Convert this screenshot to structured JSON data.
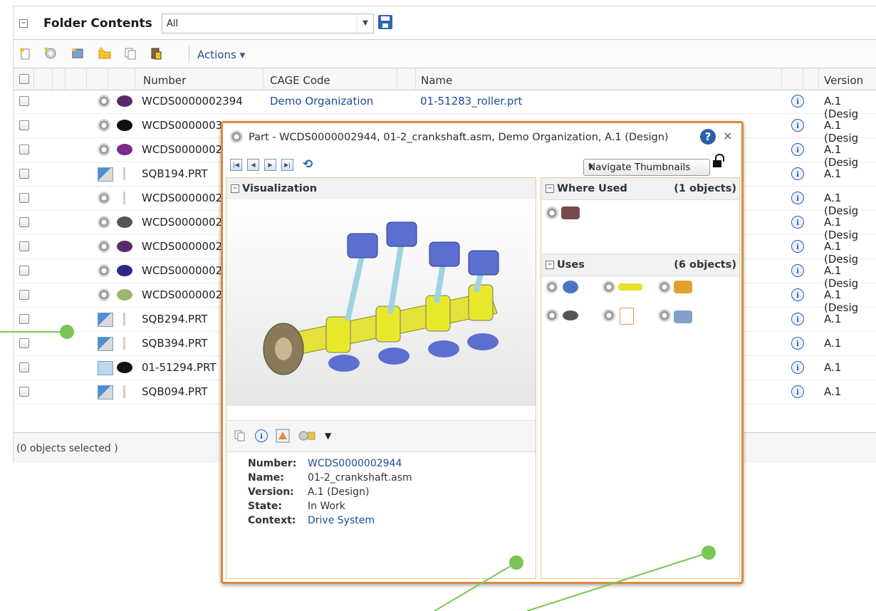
{
  "header": {
    "title": "Folder Contents",
    "filter_value": "All"
  },
  "toolbar": {
    "actions_label": "Actions"
  },
  "columns": {
    "number": "Number",
    "cage": "CAGE Code",
    "name": "Name",
    "version": "Version"
  },
  "rows": [
    {
      "number": "WCDS0000002394",
      "cage": "Demo Organization",
      "name": "01-51283_roller.prt",
      "version": "A.1 (Desig"
    },
    {
      "number": "WCDS0000003",
      "cage": "",
      "name": "",
      "version": "A.1 (Desig"
    },
    {
      "number": "WCDS0000002",
      "cage": "",
      "name": "",
      "version": "A.1 (Desig"
    },
    {
      "number": "SQB194.PRT",
      "cage": "",
      "name": "",
      "version": "A.1"
    },
    {
      "number": "WCDS0000002",
      "cage": "",
      "name": "",
      "version": "A.1 (Desig"
    },
    {
      "number": "WCDS0000002",
      "cage": "",
      "name": "",
      "version": "A.1 (Desig"
    },
    {
      "number": "WCDS0000002",
      "cage": "",
      "name": "",
      "version": "A.1 (Desig"
    },
    {
      "number": "WCDS0000002",
      "cage": "",
      "name": "",
      "version": "A.1 (Desig"
    },
    {
      "number": "WCDS0000002",
      "cage": "",
      "name": "",
      "version": "A.1 (Desig"
    },
    {
      "number": "SQB294.PRT",
      "cage": "",
      "name": "",
      "version": "A.1"
    },
    {
      "number": "SQB394.PRT",
      "cage": "",
      "name": "",
      "version": "A.1"
    },
    {
      "number": "01-51294.PRT",
      "cage": "",
      "name": "",
      "version": "A.1"
    },
    {
      "number": "SQB094.PRT",
      "cage": "",
      "name": "",
      "version": "A.1"
    }
  ],
  "footer": {
    "status": "(0 objects selected )"
  },
  "popup": {
    "title": "Part - WCDS0000002944, 01-2_crankshaft.asm, Demo Organization, A.1 (Design)",
    "navigate_label": "Navigate Thumbnails",
    "visualization_label": "Visualization",
    "where_used_label": "Where Used",
    "where_used_count": "(1 objects)",
    "uses_label": "Uses",
    "uses_count": "(6 objects)",
    "props": {
      "number_label": "Number:",
      "number": "WCDS0000002944",
      "name_label": "Name:",
      "name": "01-2_crankshaft.asm",
      "version_label": "Version:",
      "version": "A.1 (Design)",
      "state_label": "State:",
      "state": "In Work",
      "context_label": "Context:",
      "context": "Drive System"
    }
  },
  "colors": {
    "accent": "#e08a3a",
    "link": "#1d4e96",
    "callout": "#7bc653"
  },
  "icons": [
    "new-icon",
    "gear-icon",
    "view-icon",
    "folder-icon",
    "copy-icon",
    "paste-icon",
    "info-icon",
    "help-icon",
    "close-icon",
    "lock-icon",
    "refresh-icon"
  ]
}
